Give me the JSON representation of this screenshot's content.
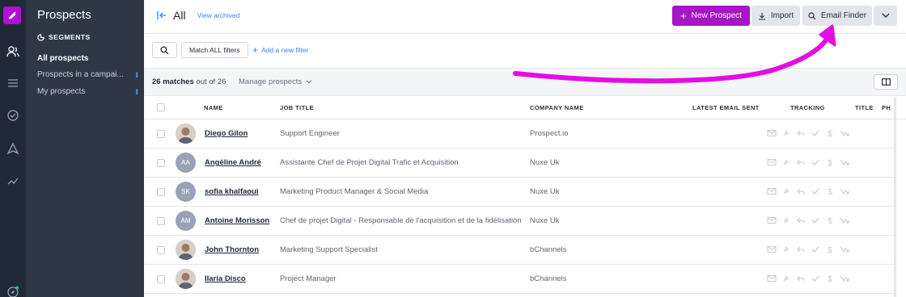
{
  "sidebar": {
    "title": "Prospects",
    "segments_label": "SEGMENTS",
    "items": [
      {
        "label": "All prospects"
      },
      {
        "label": "Prospects in a campai..."
      },
      {
        "label": "My prospects"
      }
    ]
  },
  "header": {
    "title": "All",
    "view_archived": "View archived",
    "new_prospect": "New Prospect",
    "import": "Import",
    "email_finder": "Email Finder"
  },
  "filters": {
    "match_all": "Match ALL filters",
    "add_filter": "Add a new filter"
  },
  "matches": {
    "count": "26 matches",
    "rest": "out of 26",
    "manage": "Manage prospects"
  },
  "columns": [
    "NAME",
    "JOB TITLE",
    "COMPANY NAME",
    "LATEST EMAIL SENT",
    "TRACKING",
    "TITLE",
    "PH"
  ],
  "rows": [
    {
      "name": "Diego Gilon",
      "job": "Support Engineer",
      "company": "Prospect.io",
      "initials": "",
      "photo": true
    },
    {
      "name": "Angéline André",
      "job": "Assistante Chef de Projet Digital Trafic et Acquisition",
      "company": "Nuxe Uk",
      "initials": "AA",
      "photo": false
    },
    {
      "name": "sofia khalfaoui",
      "job": "Marketing Product Manager & Social Media",
      "company": "Nuxe Uk",
      "initials": "SK",
      "photo": false
    },
    {
      "name": "Antoine Morisson",
      "job": "Chef de projet Digital - Responsable de l'acquisition et de la fidélisation",
      "company": "Nuxe Uk",
      "initials": "AM",
      "photo": false
    },
    {
      "name": "John Thornton",
      "job": "Marketing Support Specialist",
      "company": "bChannels",
      "initials": "",
      "photo": true
    },
    {
      "name": "Ilaria Disco",
      "job": "Project Manager",
      "company": "bChannels",
      "initials": "",
      "photo": true
    }
  ],
  "colors": {
    "accent": "#a615c7",
    "link": "#3b82f6",
    "sidebar": "#2f3747",
    "rail": "#1f2937",
    "annotation": "#e20ee2"
  }
}
